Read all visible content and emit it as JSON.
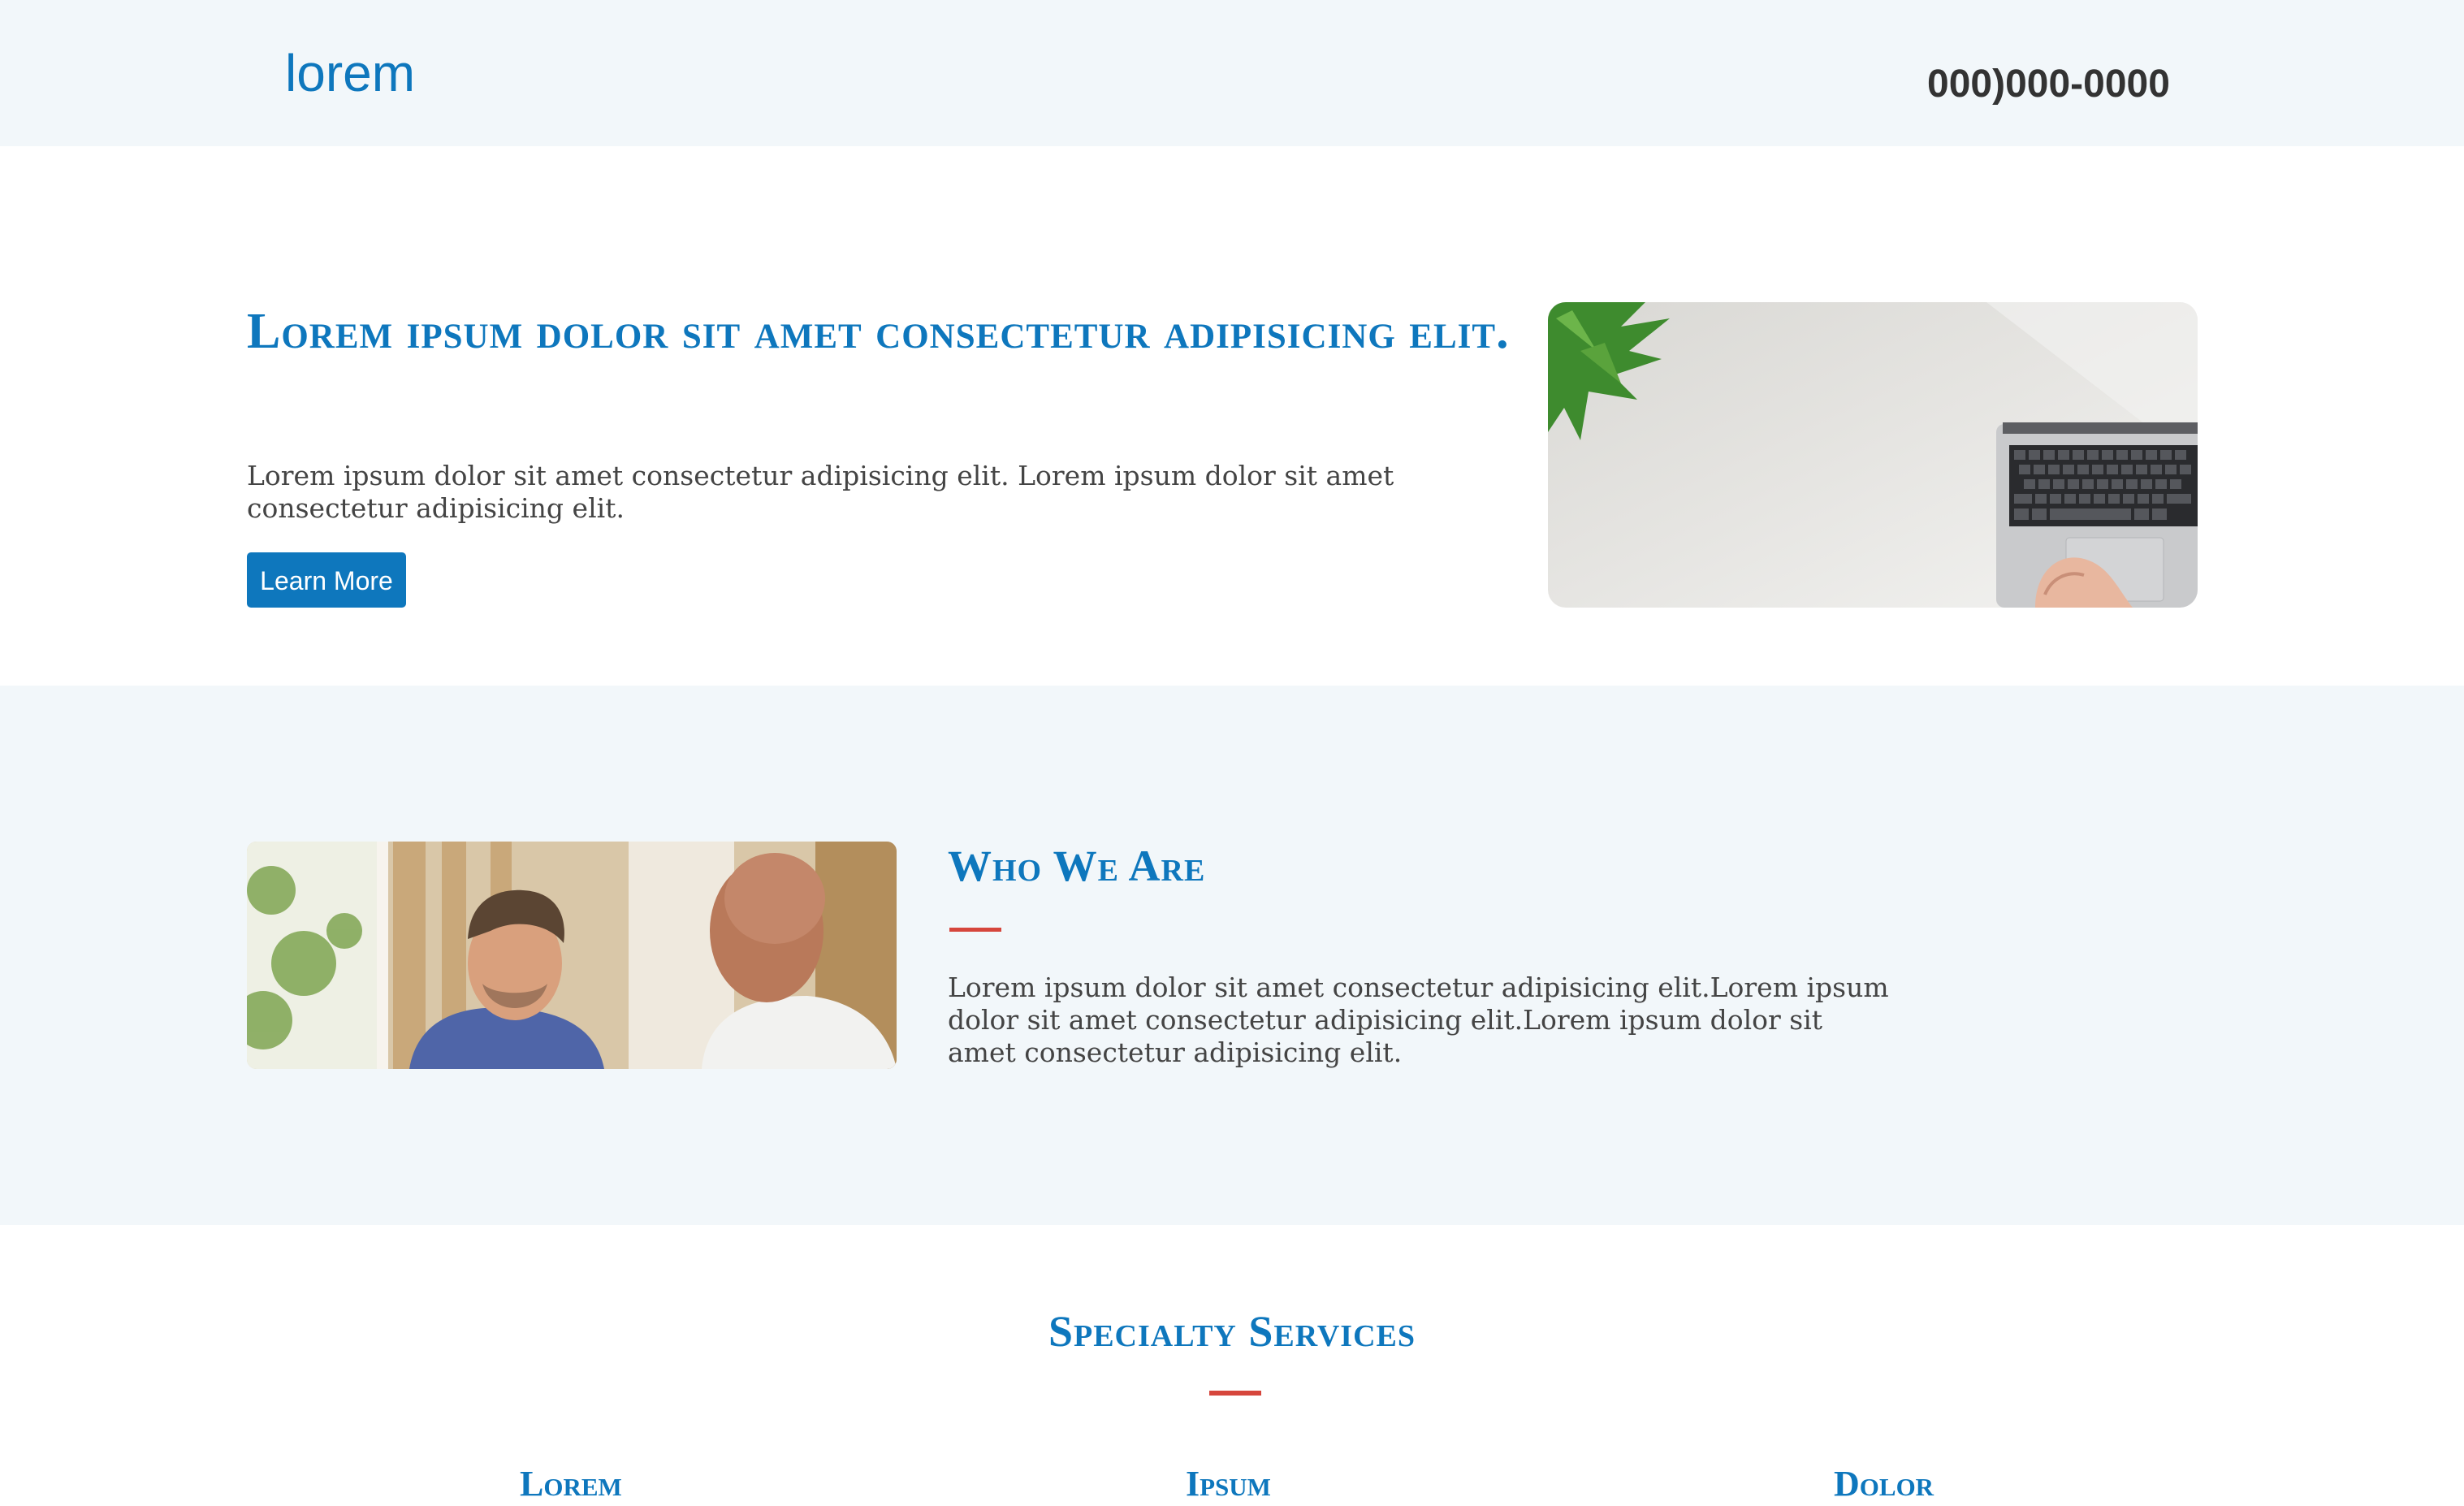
{
  "header": {
    "logo": "lorem",
    "phone": "000)000-0000"
  },
  "hero": {
    "title": "Lorem ipsum dolor sit amet consectetur adipisicing elit.",
    "text": "Lorem ipsum dolor sit amet consectetur adipisicing elit. Lorem ipsum dolor sit amet consectetur adipisicing elit.",
    "button_label": "Learn More"
  },
  "who": {
    "title": "Who We Are",
    "text": "Lorem ipsum dolor sit amet consectetur adipisicing elit.Lorem ipsum dolor sit amet consectetur adipisicing elit.Lorem ipsum dolor sit amet consectetur adipisicing elit."
  },
  "services": {
    "title": "Specialty Services",
    "columns": [
      "Lorem",
      "Ipsum",
      "Dolor"
    ]
  },
  "colors": {
    "accent": "#0e77bd",
    "rule": "#d6463c",
    "band": "#f2f7fa"
  }
}
